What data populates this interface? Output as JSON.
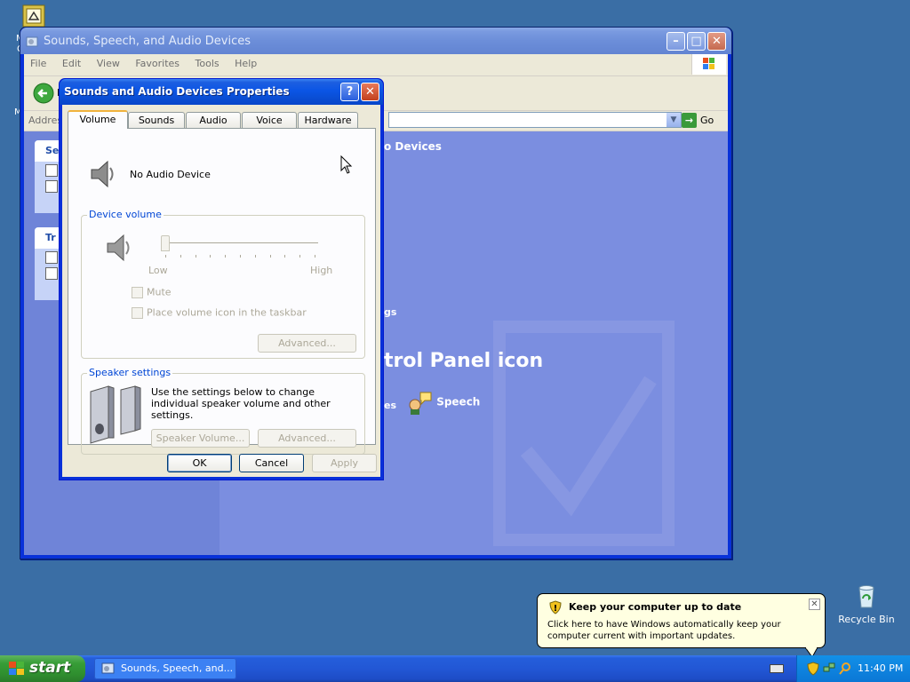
{
  "desktop": {
    "recycle_bin_label": "Recycle Bin",
    "fragment_1": "M",
    "fragment_2": "C",
    "fragment_3": "M"
  },
  "explorer": {
    "title": "Sounds, Speech, and Audio Devices",
    "menu": [
      "File",
      "Edit",
      "View",
      "Favorites",
      "Tools",
      "Help"
    ],
    "back_label_fragment": "B",
    "address_label": "Addres",
    "go_label": "Go",
    "content_title_fragment": "o Devices",
    "pick_heading_fragment": "trol Panel icon",
    "fragment_ngs": "gs",
    "fragment_es": "es",
    "speech_label": "Speech",
    "task_box_1_head": "Se",
    "task_box_2_head": "Tr"
  },
  "dialog": {
    "title": "Sounds and Audio Devices Properties",
    "tabs": [
      "Volume",
      "Sounds",
      "Audio",
      "Voice",
      "Hardware"
    ],
    "active_tab": "Volume",
    "device_name": "No Audio Device",
    "device_volume_group": "Device volume",
    "slider_low": "Low",
    "slider_high": "High",
    "volume_level": 0,
    "mute_label": "Mute",
    "taskbar_icon_label": "Place volume icon in the taskbar",
    "advanced_label": "Advanced...",
    "speaker_group": "Speaker settings",
    "speaker_text": "Use the settings below to change individual speaker volume and other settings.",
    "speaker_volume_label": "Speaker Volume...",
    "ok_label": "OK",
    "cancel_label": "Cancel",
    "apply_label": "Apply"
  },
  "balloon": {
    "title": "Keep your computer up to date",
    "text": "Click here to have Windows automatically keep your computer current with important updates."
  },
  "taskbar": {
    "start_label": "start",
    "window_label": "Sounds, Speech, and...",
    "clock": "11:40 PM"
  },
  "colors": {
    "titlebar_active": "#0a4fd6",
    "desktop": "#3a6ea5",
    "taskbar": "#245edb",
    "start": "#379d37"
  }
}
